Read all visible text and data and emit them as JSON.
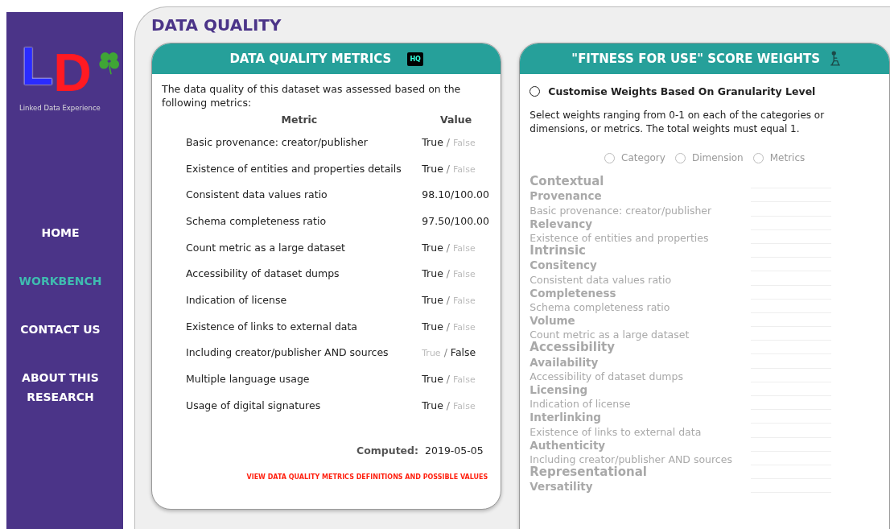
{
  "logo": {
    "letters": [
      "L",
      "D"
    ],
    "tagline": "Linked Data Experience"
  },
  "nav": [
    {
      "label": "HOME",
      "selected": false
    },
    {
      "label": "WORKBENCH",
      "selected": true
    },
    {
      "label": "CONTACT US",
      "selected": false
    },
    {
      "label": "ABOUT THIS RESEARCH",
      "selected": false
    }
  ],
  "page_title": "DATA QUALITY",
  "metrics_card": {
    "title": "DATA QUALITY METRICS",
    "badge": "HQ",
    "intro": "The data quality of this dataset was assessed based on the following metrics:",
    "columns": [
      "Metric",
      "Value"
    ],
    "rows": [
      {
        "metric": "Basic provenance: creator/publisher",
        "kind": "boolean",
        "options": [
          {
            "label": "True",
            "selected": true
          },
          {
            "label": "False",
            "selected": false
          }
        ]
      },
      {
        "metric": "Existence of entities and properties details",
        "kind": "boolean",
        "options": [
          {
            "label": "True",
            "selected": true
          },
          {
            "label": "False",
            "selected": false
          }
        ]
      },
      {
        "metric": "Consistent data values ratio",
        "kind": "ratio",
        "value": "98.10/100.00"
      },
      {
        "metric": "Schema completeness ratio",
        "kind": "ratio",
        "value": "97.50/100.00"
      },
      {
        "metric": "Count metric as a large dataset",
        "kind": "boolean",
        "options": [
          {
            "label": "True",
            "selected": true
          },
          {
            "label": "False",
            "selected": false
          }
        ]
      },
      {
        "metric": "Accessibility of dataset dumps",
        "kind": "boolean",
        "options": [
          {
            "label": "True",
            "selected": true
          },
          {
            "label": "False",
            "selected": false
          }
        ]
      },
      {
        "metric": "Indication of license",
        "kind": "boolean",
        "options": [
          {
            "label": "True",
            "selected": true
          },
          {
            "label": "False",
            "selected": false
          }
        ]
      },
      {
        "metric": "Existence of links to external data",
        "kind": "boolean",
        "options": [
          {
            "label": "True",
            "selected": true
          },
          {
            "label": "False",
            "selected": false
          }
        ]
      },
      {
        "metric": "Including creator/publisher AND sources",
        "kind": "boolean",
        "options": [
          {
            "label": "True",
            "selected": false
          },
          {
            "label": "False",
            "selected": true
          }
        ]
      },
      {
        "metric": "Multiple language usage",
        "kind": "boolean",
        "options": [
          {
            "label": "True",
            "selected": true
          },
          {
            "label": "False",
            "selected": false
          }
        ]
      },
      {
        "metric": "Usage of digital signatures",
        "kind": "boolean",
        "options": [
          {
            "label": "True",
            "selected": true
          },
          {
            "label": "False",
            "selected": false
          }
        ]
      }
    ],
    "value_separator": "/",
    "computed_label": "Computed:",
    "computed_value": "2019-05-05",
    "link": "VIEW DATA QUALITY METRICS DEFINITIONS AND POSSIBLE VALUES"
  },
  "weights_card": {
    "title": "\"FITNESS FOR USE\" SCORE WEIGHTS",
    "customise": {
      "label": "Customise Weights Based On Granularity Level",
      "checked": false
    },
    "instructions": "Select weights ranging from 0-1 on each of the categories or dimensions, or metrics. The total weights must equal 1.",
    "levels": [
      {
        "label": "Category",
        "selected": false
      },
      {
        "label": "Dimension",
        "selected": false
      },
      {
        "label": "Metrics",
        "selected": false
      }
    ],
    "disabled": true,
    "items": [
      {
        "label": "Contextual",
        "kind": "category"
      },
      {
        "label": "Provenance",
        "kind": "dimension"
      },
      {
        "label": "Basic provenance: creator/publisher",
        "kind": "metric"
      },
      {
        "label": "Relevancy",
        "kind": "dimension"
      },
      {
        "label": "Existence of entities and properties",
        "kind": "metric"
      },
      {
        "label": "Intrinsic",
        "kind": "category"
      },
      {
        "label": "Consitency",
        "kind": "dimension"
      },
      {
        "label": "Consistent data values ratio",
        "kind": "metric"
      },
      {
        "label": "Completeness",
        "kind": "dimension"
      },
      {
        "label": "Schema completeness ratio",
        "kind": "metric"
      },
      {
        "label": "Volume",
        "kind": "dimension"
      },
      {
        "label": "Count metric as a large dataset",
        "kind": "metric"
      },
      {
        "label": "Accessibility",
        "kind": "category"
      },
      {
        "label": "Availability",
        "kind": "dimension"
      },
      {
        "label": "Accessibility of dataset dumps",
        "kind": "metric"
      },
      {
        "label": "Licensing",
        "kind": "dimension"
      },
      {
        "label": "Indication of license",
        "kind": "metric"
      },
      {
        "label": "Interlinking",
        "kind": "dimension"
      },
      {
        "label": "Existence of links to external data",
        "kind": "metric"
      },
      {
        "label": "Authenticity",
        "kind": "dimension"
      },
      {
        "label": "Including creator/publisher AND sources",
        "kind": "metric"
      },
      {
        "label": "Representational",
        "kind": "category"
      },
      {
        "label": "Versatility",
        "kind": "dimension"
      }
    ]
  }
}
